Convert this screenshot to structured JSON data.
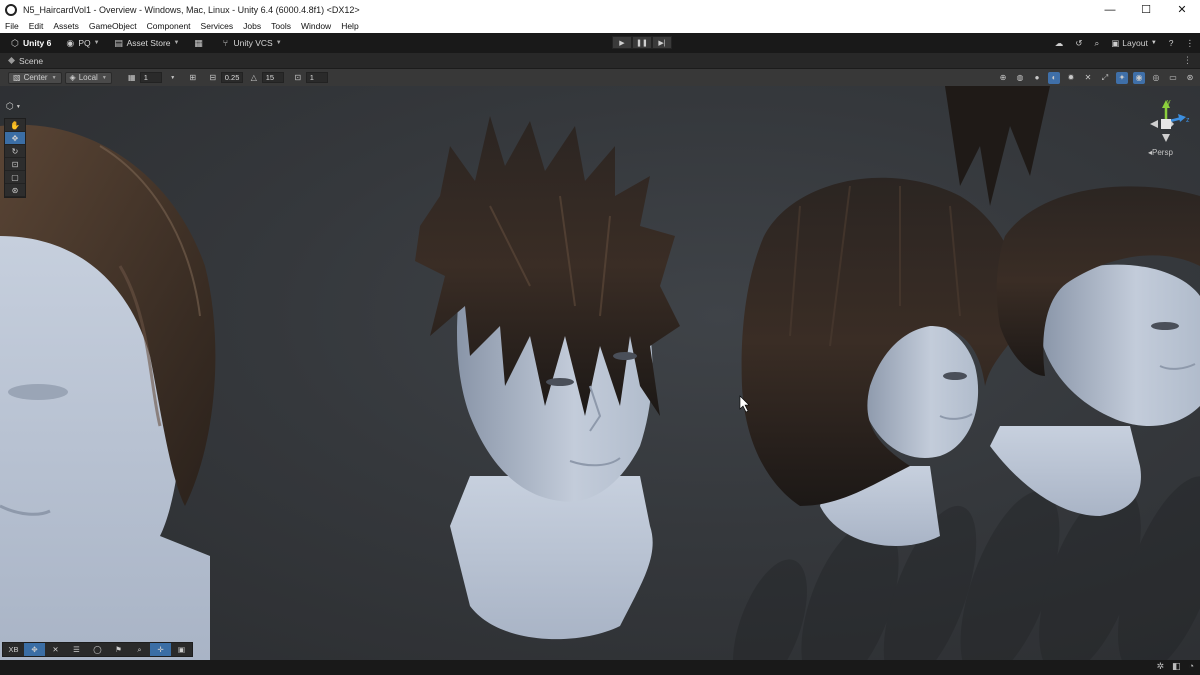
{
  "window": {
    "title": "N5_HaircardVol1 - Overview - Windows, Mac, Linux - Unity 6.4 (6000.4.8f1) <DX12>",
    "minimize": "—",
    "maximize": "☐",
    "close": "✕"
  },
  "menu": [
    "File",
    "Edit",
    "Assets",
    "GameObject",
    "Component",
    "Services",
    "Jobs",
    "Tools",
    "Window",
    "Help"
  ],
  "toolbar": {
    "unity_label": "Unity 6",
    "account_label": "PQ",
    "asset_store_label": "Asset Store",
    "vcs_label": "Unity VCS",
    "layout_label": "Layout"
  },
  "scene_tab": {
    "label": "Scene"
  },
  "scene_toolbar": {
    "pivot_mode": "Center",
    "pivot_rotation": "Local",
    "grid_count": "1",
    "snap_increment": "0.25",
    "rotate_snap": "15",
    "scale_snap": "1"
  },
  "view": {
    "projection_label": "◂Persp",
    "gizmo_axes": {
      "y": "y",
      "z": "z"
    }
  },
  "overlay_toolbar": [
    "XB",
    "✥",
    "✕",
    "☰",
    "◯",
    "⚑",
    "⌕",
    "✛",
    "▣"
  ],
  "colors": {
    "accent": "#3b6ea5",
    "axis_x": "#e0503c",
    "axis_y": "#8ccf3c",
    "axis_z": "#3c8fe0"
  }
}
